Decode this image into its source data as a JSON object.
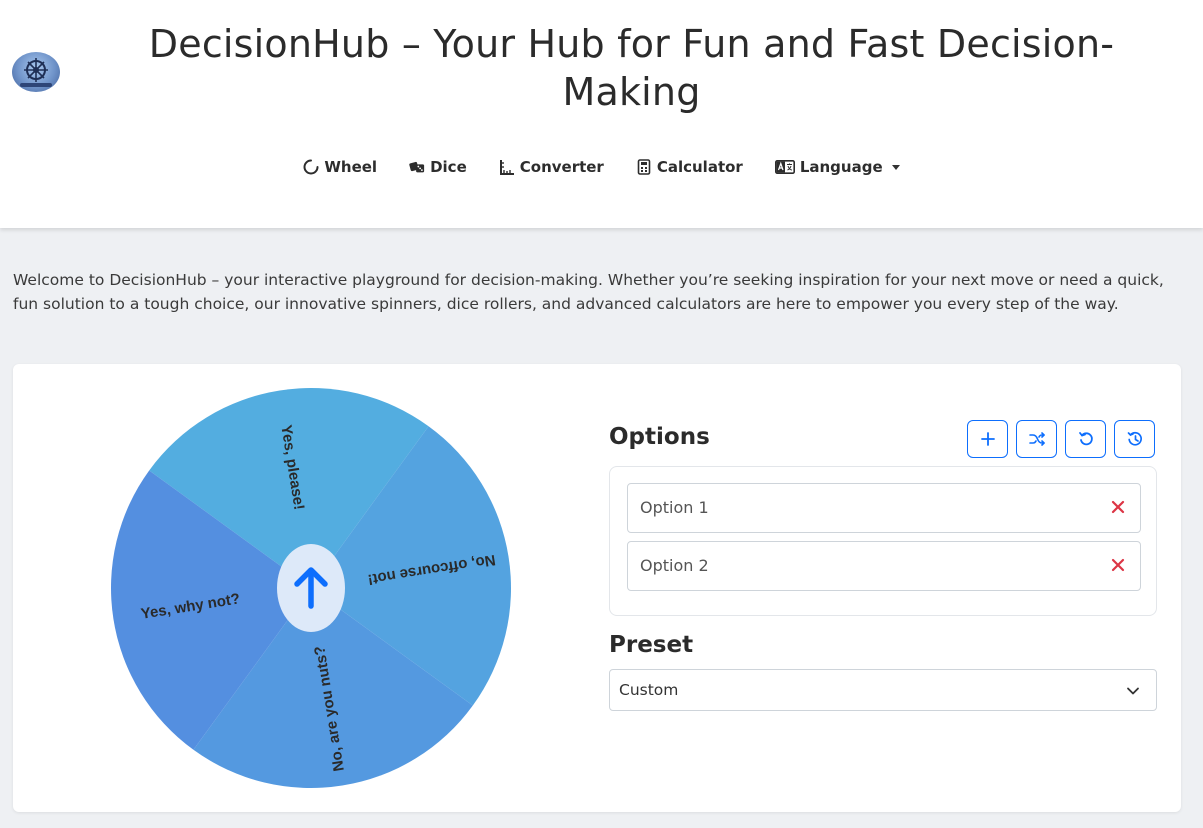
{
  "header": {
    "title": "DecisionHub – Your Hub for Fun and Fast Decision-Making",
    "logo_icon": "ship-wheel-logo"
  },
  "nav": {
    "items": [
      {
        "label": "Wheel",
        "icon": "circle-notch-icon"
      },
      {
        "label": "Dice",
        "icon": "dice-icon"
      },
      {
        "label": "Converter",
        "icon": "ruler-icon"
      },
      {
        "label": "Calculator",
        "icon": "calculator-icon"
      },
      {
        "label": "Language",
        "icon": "translate-icon"
      }
    ]
  },
  "intro": {
    "text": "Welcome to DecisionHub – your interactive playground for decision-making. Whether you’re seeking inspiration for your next move or need a quick, fun solution to a tough choice, our innovative spinners, dice rollers, and advanced calculators are here to empower you every step of the way."
  },
  "wheel": {
    "segments": [
      {
        "label": "Yes, please!",
        "color": "#53ade0"
      },
      {
        "label": "No, offcourse not!",
        "color": "#54a3e0"
      },
      {
        "label": "No, are you nuts?",
        "color": "#5499e0"
      },
      {
        "label": "Yes, why not?",
        "color": "#548fe0"
      }
    ],
    "hub_icon": "arrow-up-icon"
  },
  "options": {
    "title": "Options",
    "buttons": [
      {
        "icon": "plus-icon"
      },
      {
        "icon": "shuffle-icon"
      },
      {
        "icon": "undo-icon"
      },
      {
        "icon": "history-icon"
      }
    ],
    "items": [
      {
        "value": "Option 1"
      },
      {
        "value": "Option 2"
      }
    ]
  },
  "preset": {
    "title": "Preset",
    "selected": "Custom"
  },
  "colors": {
    "accent": "#0d6efd",
    "delete": "#dc3545"
  }
}
